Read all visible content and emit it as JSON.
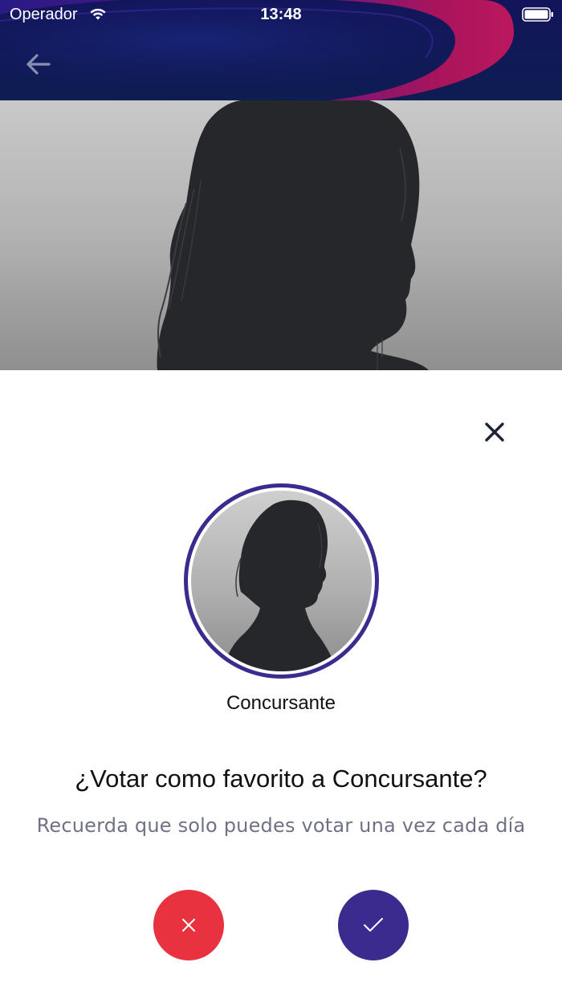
{
  "status_bar": {
    "carrier": "Operador",
    "time": "13:48",
    "wifi_icon": "wifi-icon",
    "battery_icon": "battery-full-icon"
  },
  "header": {
    "back_icon": "arrow-left-icon",
    "background": "#13145a",
    "accent": "#b0145c"
  },
  "hero": {
    "image": "contestant-silhouette-photo"
  },
  "vote_dialog": {
    "close_icon": "close-icon",
    "contestant_name": "Concursante",
    "question": "¿Votar como favorito a Concursante?",
    "hint": "Recuerda que solo puedes votar una vez cada día",
    "reject_icon": "close-icon",
    "accept_icon": "checkmark-icon",
    "colors": {
      "ring": "#3b2b8f",
      "reject": "#e8323f",
      "accept": "#3b2b8f",
      "hint_text": "#6f7283"
    }
  }
}
